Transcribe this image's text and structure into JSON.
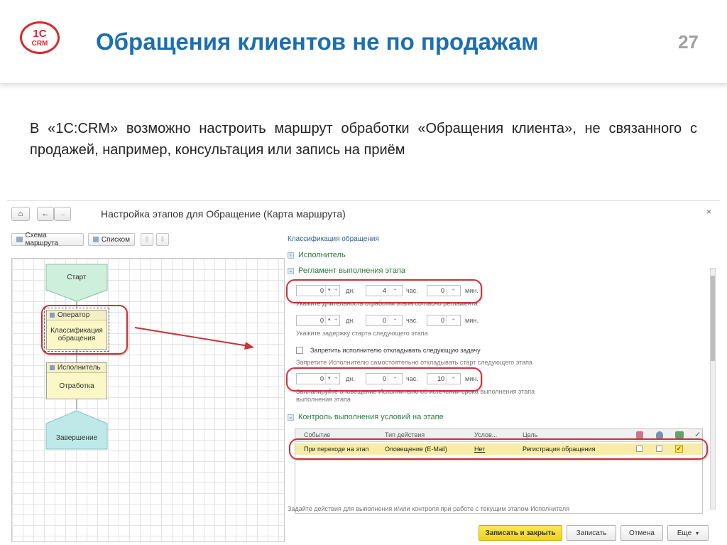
{
  "slide": {
    "logo_top": "1С",
    "logo_bottom": "CRM",
    "title": "Обращения клиентов не по продажам",
    "page_number": "27",
    "intro": "В «1С:CRM» возможно настроить маршрут обработки «Обращения клиента», не связанного с продажей, например, консультация или запись на приём"
  },
  "window": {
    "title": "Настройка этапов для Обращение (Карта маршрута)",
    "close": "×",
    "nav": {
      "home": "⌂",
      "back": "←",
      "forward": "→"
    },
    "tools": {
      "scheme": "Схема маршрута",
      "list": "Списком",
      "up": "⇧",
      "down": "⇩"
    }
  },
  "diagram": {
    "start": "Старт",
    "operator_role": "Оператор",
    "operator_task": "Классификация обращения",
    "executor_role": "Исполнитель",
    "executor_task": "Отработка",
    "finish": "Завершение"
  },
  "panel": {
    "section_title": "Классификация обращения",
    "group_executor": "Исполнитель",
    "group_reglament": "Регламент выполнения этапа",
    "duration": {
      "days": "0",
      "hours": "4",
      "minutes": "0"
    },
    "units": {
      "days": "дн.",
      "hours": "час.",
      "minutes": "мин."
    },
    "duration_hint": "Укажите длительность отработки этапа согласно регламента",
    "delay": {
      "days": "0",
      "hours": "0",
      "minutes": "0"
    },
    "delay_hint": "Укажите задержку старта следующего этапа",
    "forbid_label": "Запретить исполнителю откладывать следующую задачу",
    "forbid_hint": "Запретите Исполнителю самостоятельно откладывать старт следующего этапа",
    "notify": {
      "days": "0",
      "hours": "0",
      "minutes": "10"
    },
    "notify_hint": "Запланируйте оповещение Исполнителю об истечении срока выполнения этапа выполнения этапа",
    "group_control": "Контроль выполнения условий на этапе",
    "table": {
      "headers": [
        "Событие",
        "Тип действия",
        "Услов...",
        "Цель"
      ],
      "row": {
        "event": "При переходе на этап",
        "action": "Оповещение (E-Mail)",
        "condition": "Нет",
        "goal": "Регистрация обращения"
      },
      "check_mark": "✓"
    },
    "footer_hint": "Задайте действия для выполнения и/или контроля при работе с текущим этапом Исполнителя"
  },
  "buttons": {
    "save_close": "Записать и закрыть",
    "save": "Записать",
    "cancel": "Отмена",
    "more": "Еще"
  },
  "colors": {
    "title_blue": "#1b6fb0",
    "logo_red": "#d42a2f",
    "oval_red": "#c9333a",
    "start_green": "#cdefdc",
    "finish_teal": "#bfe9e8",
    "task_yellow": "#fbf7c6",
    "row_yellow": "#f7eda6"
  }
}
